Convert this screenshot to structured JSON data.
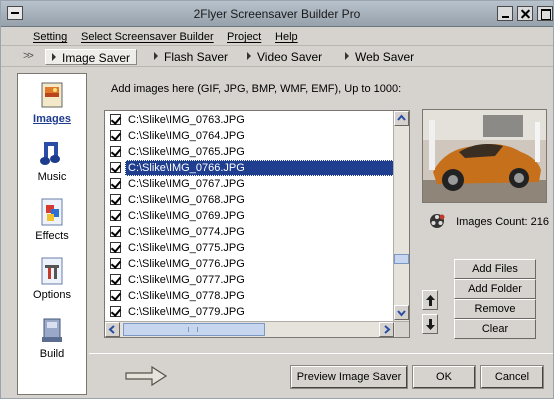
{
  "window": {
    "title": "2Flyer Screensaver Builder Pro"
  },
  "menu": [
    "Setting",
    "Select Screensaver Builder",
    "Project",
    "Help"
  ],
  "tabs": [
    {
      "label": "Image Saver",
      "active": true
    },
    {
      "label": "Flash Saver",
      "active": false
    },
    {
      "label": "Video Saver",
      "active": false
    },
    {
      "label": "Web Saver",
      "active": false
    }
  ],
  "nav": [
    {
      "label": "Images",
      "icon": "images-icon",
      "active": true
    },
    {
      "label": "Music",
      "icon": "music-icon",
      "active": false
    },
    {
      "label": "Effects",
      "icon": "effects-icon",
      "active": false
    },
    {
      "label": "Options",
      "icon": "options-icon",
      "active": false
    },
    {
      "label": "Build",
      "icon": "build-icon",
      "active": false
    }
  ],
  "main": {
    "instruction": "Add images here (GIF, JPG, BMP, WMF, EMF), Up to 1000:",
    "files": [
      {
        "path": "C:\\Slike\\IMG_0763.JPG",
        "checked": true,
        "selected": false
      },
      {
        "path": "C:\\Slike\\IMG_0764.JPG",
        "checked": true,
        "selected": false
      },
      {
        "path": "C:\\Slike\\IMG_0765.JPG",
        "checked": true,
        "selected": false
      },
      {
        "path": "C:\\Slike\\IMG_0766.JPG",
        "checked": true,
        "selected": true
      },
      {
        "path": "C:\\Slike\\IMG_0767.JPG",
        "checked": true,
        "selected": false
      },
      {
        "path": "C:\\Slike\\IMG_0768.JPG",
        "checked": true,
        "selected": false
      },
      {
        "path": "C:\\Slike\\IMG_0769.JPG",
        "checked": true,
        "selected": false
      },
      {
        "path": "C:\\Slike\\IMG_0774.JPG",
        "checked": true,
        "selected": false
      },
      {
        "path": "C:\\Slike\\IMG_0775.JPG",
        "checked": true,
        "selected": false
      },
      {
        "path": "C:\\Slike\\IMG_0776.JPG",
        "checked": true,
        "selected": false
      },
      {
        "path": "C:\\Slike\\IMG_0777.JPG",
        "checked": true,
        "selected": false
      },
      {
        "path": "C:\\Slike\\IMG_0778.JPG",
        "checked": true,
        "selected": false
      },
      {
        "path": "C:\\Slike\\IMG_0779.JPG",
        "checked": true,
        "selected": false
      }
    ],
    "images_count": "Images Count: 216"
  },
  "side_buttons": {
    "add_files": "Add Files",
    "add_folder": "Add Folder",
    "remove": "Remove",
    "clear": "Clear"
  },
  "footer": {
    "preview": "Preview Image Saver",
    "ok": "OK",
    "cancel": "Cancel"
  },
  "colors": {
    "selection": "#1f3e8f",
    "window_bg": "#d6d3ce",
    "titlebar": "#a7b1bb"
  }
}
